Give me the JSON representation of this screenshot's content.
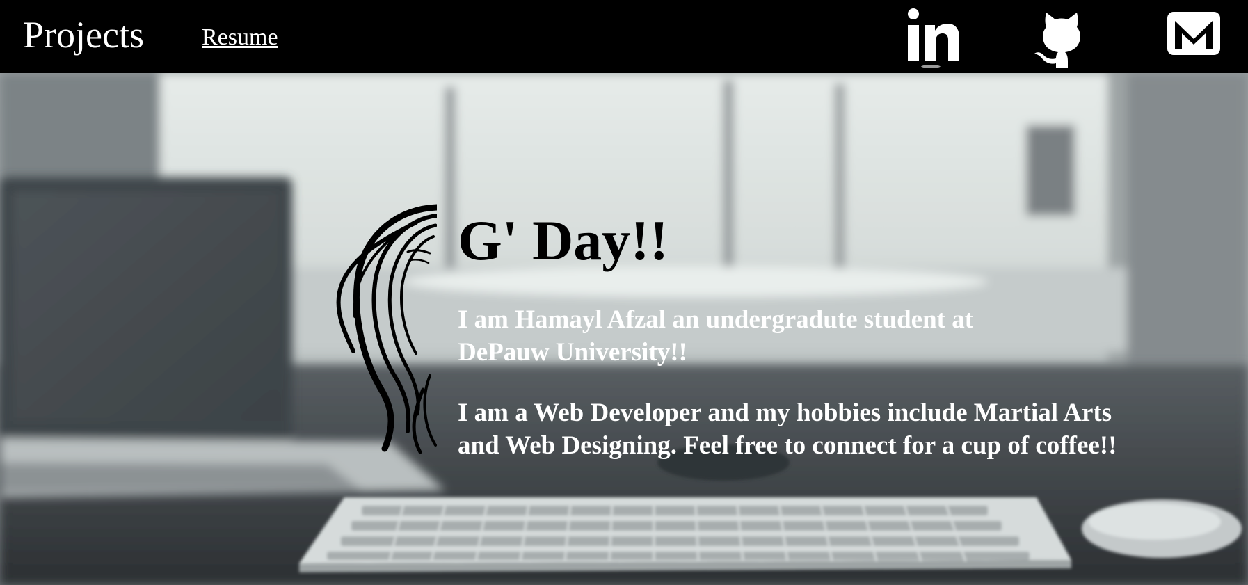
{
  "nav": {
    "brand": "Projects",
    "links": [
      {
        "label": "Resume"
      }
    ],
    "social": [
      {
        "name": "LinkedIn",
        "icon": "linkedin-icon"
      },
      {
        "name": "GitHub",
        "icon": "github-icon"
      },
      {
        "name": "Email",
        "icon": "mail-icon"
      }
    ]
  },
  "intro": {
    "greeting": "G' Day!!",
    "paragraph1": "I am Hamayl Afzal an undergradute student at DePauw University!!",
    "paragraph2": "I am a Web Developer and my hobbies include Martial Arts and Web Designing. Feel free to connect for a cup of coffee!!"
  },
  "background": {
    "scene": "desk-with-laptop-keyboard-mouse",
    "palette": [
      "#000000",
      "#ffffff",
      "#6d7377",
      "#d6dcdc"
    ]
  }
}
